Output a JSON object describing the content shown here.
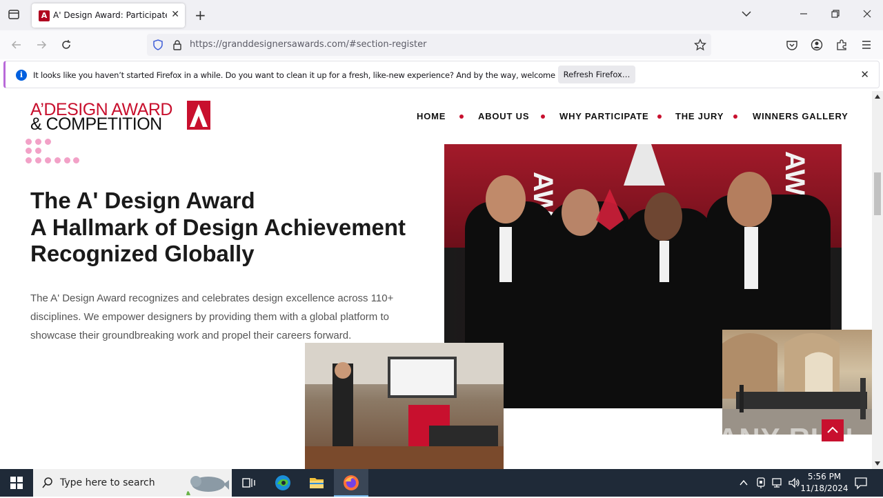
{
  "browser": {
    "tab_title": "A' Design Award: Participate for",
    "url_host": "https://granddesignersawards.com",
    "url_path": "/#section-register",
    "new_tab": "+",
    "close_tab": "✕"
  },
  "notification": {
    "message": "It looks like you haven’t started Firefox in a while. Do you want to clean it up for a fresh, like-new experience? And by the way, welcome back!",
    "button": "Refresh Firefox…",
    "close": "✕"
  },
  "site": {
    "logo_line1": "A’DESIGN AWARD",
    "logo_line2": "& COMPETITION",
    "nav": [
      "HOME",
      "ABOUT US",
      "WHY PARTICIPATE",
      "THE JURY",
      "WINNERS GALLERY"
    ],
    "headline": [
      "The A' Design Award",
      "A Hallmark of Design Achievement",
      "Recognized Globally"
    ],
    "description": "The A' Design Award recognizes and celebrates design excellence across 110+ disciplines. We empower designers by providing them with a global platform to showcase their groundbreaking work and propel their careers forward.",
    "scroll_top_icon": "chevron-up-icon",
    "watermark": "ANY RUN"
  },
  "taskbar": {
    "search_placeholder": "Type here to search",
    "time": "5:56 PM",
    "date": "11/18/2024"
  },
  "colors": {
    "brand_red": "#c8102e",
    "accent_pink": "#f2a1c7",
    "taskbar": "#1f2a38"
  }
}
